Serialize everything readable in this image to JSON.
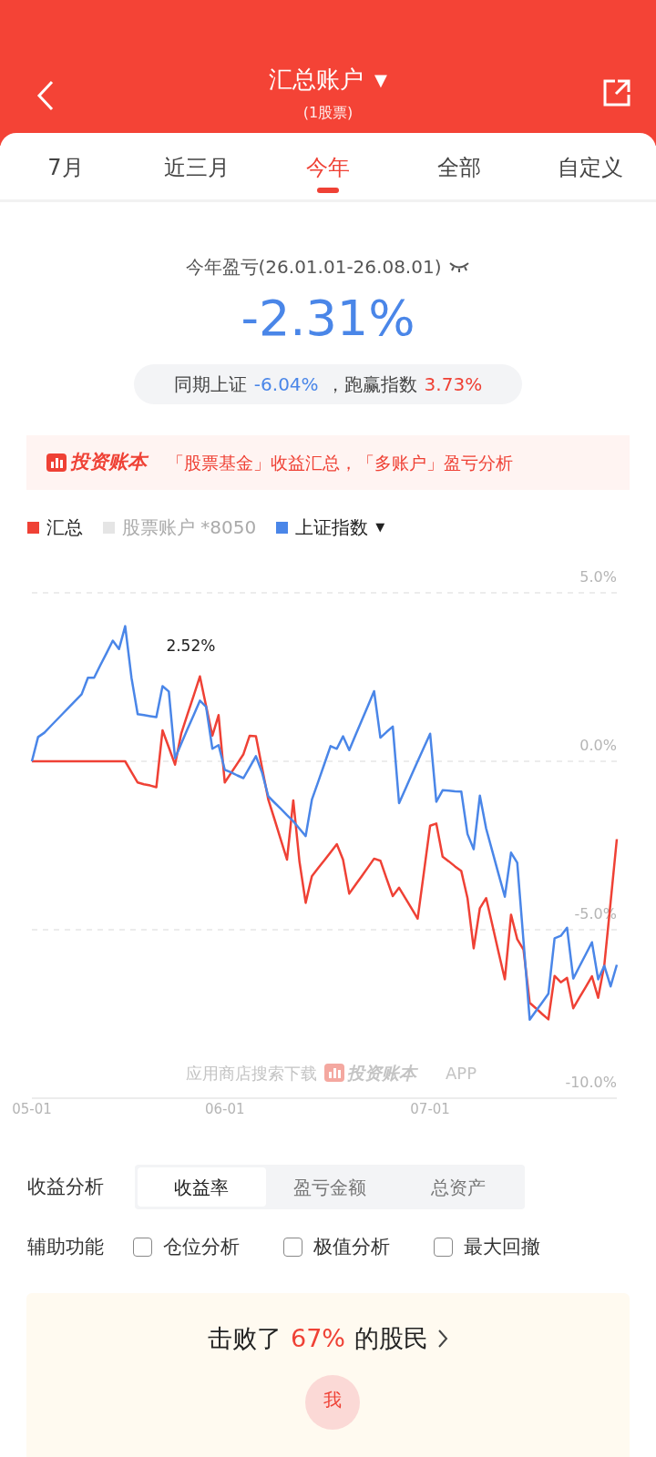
{
  "header": {
    "title": "汇总账户",
    "title_caret": "▼",
    "subtitle": "(1股票)"
  },
  "tabs": [
    {
      "label": "7月",
      "selected": false
    },
    {
      "label": "近三月",
      "selected": false
    },
    {
      "label": "今年",
      "selected": true
    },
    {
      "label": "全部",
      "selected": false
    },
    {
      "label": "自定义",
      "selected": false
    }
  ],
  "summary": {
    "label": "今年盈亏(26.01.01-26.08.01)",
    "value": "-2.31%",
    "index_label": "同期上证",
    "index_value": "-6.04%",
    "excess_label": "，跑赢指数",
    "excess_value": "3.73%"
  },
  "banner": {
    "brand": "投资账本",
    "text": "「股票基金」收益汇总，「多账户」盈亏分析"
  },
  "legend": [
    {
      "kind": "series",
      "on": true
    },
    {
      "kind": "account",
      "label": "股票账户 *8050",
      "color": "#e5e5e5",
      "on": false
    },
    {
      "kind": "series",
      "on": true,
      "caret": "▼"
    }
  ],
  "chart": {
    "footnote": "应用商店搜索下载",
    "footnote_brand": "投资账本",
    "footnote_suffix": "APP",
    "chart_data": {
      "type": "line",
      "categories": [
        "05-01",
        null,
        null,
        null,
        null,
        null,
        null,
        null,
        null,
        null,
        null,
        null,
        null,
        null,
        null,
        null,
        null,
        null,
        null,
        null,
        null,
        null,
        null,
        null,
        null,
        null,
        null,
        null,
        null,
        null,
        null,
        "06-01",
        null,
        null,
        null,
        null,
        null,
        null,
        null,
        null,
        null,
        null,
        null,
        null,
        null,
        null,
        null,
        null,
        null,
        null,
        null,
        null,
        null,
        null,
        null,
        null,
        null,
        null,
        null,
        null,
        null,
        null,
        null,
        null,
        "07-01",
        null,
        null,
        null,
        null,
        null,
        null,
        null,
        null,
        null,
        null,
        null,
        null,
        null,
        null,
        null,
        null,
        null,
        null,
        null,
        null,
        null,
        null,
        null,
        null,
        null,
        null,
        null,
        null,
        null,
        null
      ],
      "series": [
        {
          "name": "汇总",
          "color": "#ef4135",
          "values": [
            0,
            0,
            0,
            0,
            0,
            0,
            0,
            0,
            0,
            0,
            0,
            0,
            0,
            0,
            0,
            0,
            -0.32,
            -0.63,
            -0.68,
            -0.72,
            -0.77,
            0.92,
            0.41,
            -0.1,
            0.82,
            1.39,
            1.95,
            2.52,
            1.64,
            0.76,
            1.37,
            -0.63,
            -0.35,
            -0.07,
            0.21,
            0.76,
            0.74,
            -0.2,
            -1.14,
            -1.73,
            -2.33,
            -2.92,
            -1.16,
            -2.98,
            -4.2,
            -3.41,
            -3.17,
            -2.94,
            -2.7,
            -2.46,
            -2.92,
            -3.93,
            -3.67,
            -3.41,
            -3.15,
            -2.89,
            -2.95,
            -3.48,
            -4.0,
            -3.75,
            -4.06,
            -4.36,
            -4.67,
            -3.29,
            -1.91,
            -1.85,
            -2.83,
            -2.97,
            -3.12,
            -3.26,
            -4.06,
            -5.55,
            -4.36,
            -4.06,
            -4.86,
            -5.67,
            -6.47,
            -4.55,
            -5.28,
            -5.59,
            -7.17,
            -7.33,
            -7.5,
            -7.66,
            -6.37,
            -6.56,
            -6.43,
            -7.33,
            -7.01,
            -6.7,
            -6.38,
            -7.02,
            -6.04,
            -4.18,
            -2.31
          ]
        },
        {
          "name": "上证指数",
          "color": "#4a86e8",
          "values": [
            0,
            0.72,
            0.85,
            1.04,
            1.23,
            1.42,
            1.61,
            1.8,
            1.99,
            2.48,
            2.48,
            2.85,
            3.21,
            3.58,
            3.33,
            4.01,
            2.48,
            1.4,
            1.37,
            1.34,
            1.31,
            2.23,
            2.07,
            0.09,
            0.52,
            0.95,
            1.37,
            1.8,
            1.62,
            0.37,
            0.48,
            -0.25,
            -0.33,
            -0.42,
            -0.5,
            -0.18,
            0.15,
            -0.34,
            -1.04,
            -1.23,
            -1.41,
            -1.6,
            -1.78,
            -2.0,
            -2.22,
            -1.14,
            -0.61,
            -0.08,
            0.45,
            0.37,
            0.74,
            0.33,
            0.77,
            1.21,
            1.64,
            2.08,
            0.7,
            0.87,
            1.03,
            -1.24,
            -0.83,
            -0.41,
            0,
            0.41,
            0.82,
            -1.2,
            -0.86,
            -0.87,
            -0.89,
            -0.9,
            -2.16,
            -2.61,
            -1.02,
            -2.0,
            -2.67,
            -3.35,
            -4.02,
            -2.71,
            -3.01,
            -5.34,
            -7.67,
            -7.41,
            -7.16,
            -6.9,
            -5.25,
            -5.18,
            -4.94,
            -6.45,
            -6.09,
            -5.73,
            -5.37,
            -6.47,
            -6.07,
            -6.68,
            -6.04
          ]
        }
      ],
      "ylim": [
        -10,
        5
      ],
      "yticks": [
        {
          "value": 5,
          "label": "5.0%"
        },
        {
          "value": 0,
          "label": "0.0%"
        },
        {
          "value": -5,
          "label": "-5.0%"
        },
        {
          "value": -10,
          "label": "-10.0%"
        }
      ],
      "annotations": [
        "2.52%"
      ]
    }
  },
  "analysis": {
    "label": "收益分析",
    "options": [
      {
        "label": "收益率",
        "selected": true
      },
      {
        "label": "盈亏金额",
        "selected": false
      },
      {
        "label": "总资产",
        "selected": false
      }
    ]
  },
  "aux": {
    "label": "辅助功能",
    "options": [
      {
        "label": "仓位分析",
        "checked": false
      },
      {
        "label": "极值分析",
        "checked": false
      },
      {
        "label": "最大回撤",
        "checked": false
      }
    ]
  },
  "rank": {
    "prefix": "击败了",
    "value": "67%",
    "suffix": "的股民",
    "me": "我"
  }
}
